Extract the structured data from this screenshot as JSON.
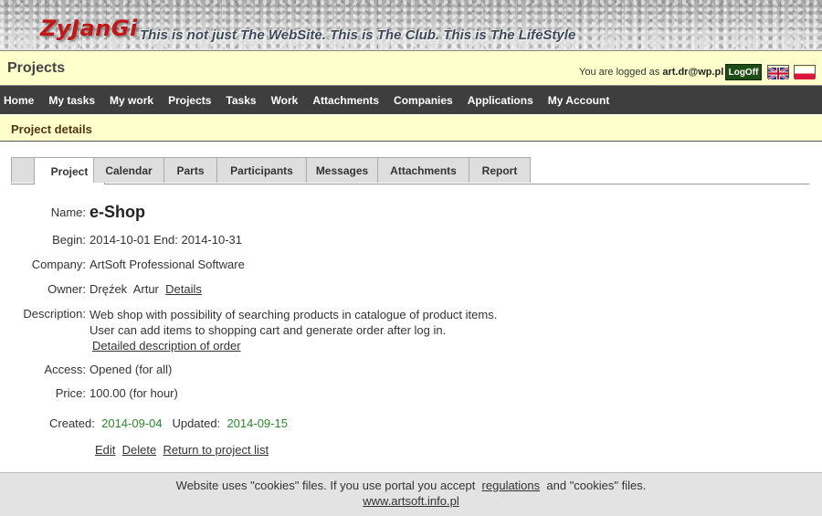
{
  "header": {
    "logo": "ZyJanGi",
    "tagline": "This is not just The WebSite. This is The Club. This is The LifeStyle"
  },
  "titlebar": {
    "title": "Projects",
    "logged_prefix": "You are logged as",
    "user": "art.dr@wp.pl",
    "logoff_label": "LogOff"
  },
  "nav": {
    "items": [
      "Home",
      "My tasks",
      "My work",
      "Projects",
      "Tasks",
      "Work",
      "Attachments",
      "Companies",
      "Applications",
      "My Account"
    ]
  },
  "section": {
    "title": "Project details"
  },
  "tabs": {
    "items": [
      "Project",
      "Calendar",
      "Parts",
      "Participants",
      "Messages",
      "Attachments",
      "Report"
    ],
    "active": "Project"
  },
  "details": {
    "name_label": "Name:",
    "name": "e-Shop",
    "begin_label": "Begin:",
    "begin": "2014-10-01",
    "end_label": "End:",
    "end": "2014-10-31",
    "company_label": "Company:",
    "company": "ArtSoft Professional Software",
    "owner_label": "Owner:",
    "owner_surname": "Dręźek",
    "owner_name": "Artur",
    "owner_link": "Details",
    "description_label": "Description:",
    "description_line1": "Web shop with possibility of searching products in catalogue of product items.",
    "description_line2": "User can add items to shopping cart and generate order after log in.",
    "description_link": "Detailed description of order",
    "access_label": "Access:",
    "access": "Opened (for all)",
    "price_label": "Price:",
    "price": "100.00 (for hour)",
    "created_label": "Created:",
    "created": "2014-09-04",
    "updated_label": "Updated:",
    "updated": "2014-09-15"
  },
  "actions": {
    "edit": "Edit",
    "delete": "Delete",
    "back": "Return to project list"
  },
  "footer": {
    "text_before": "Website uses \"cookies\" files. If you use portal you accept",
    "regulations": "regulations",
    "text_after": "and \"cookies\" files.",
    "url": "www.artsoft.info.pl"
  },
  "colors": {
    "navbar": "#3e3e3e",
    "titlebar": "#ffffcc",
    "logo": "#c21717",
    "logoff": "#1c4d14",
    "date_green": "#2a8a2a"
  },
  "icons": {
    "flag_en": "uk-flag-icon",
    "flag_pl": "pl-flag-icon"
  }
}
